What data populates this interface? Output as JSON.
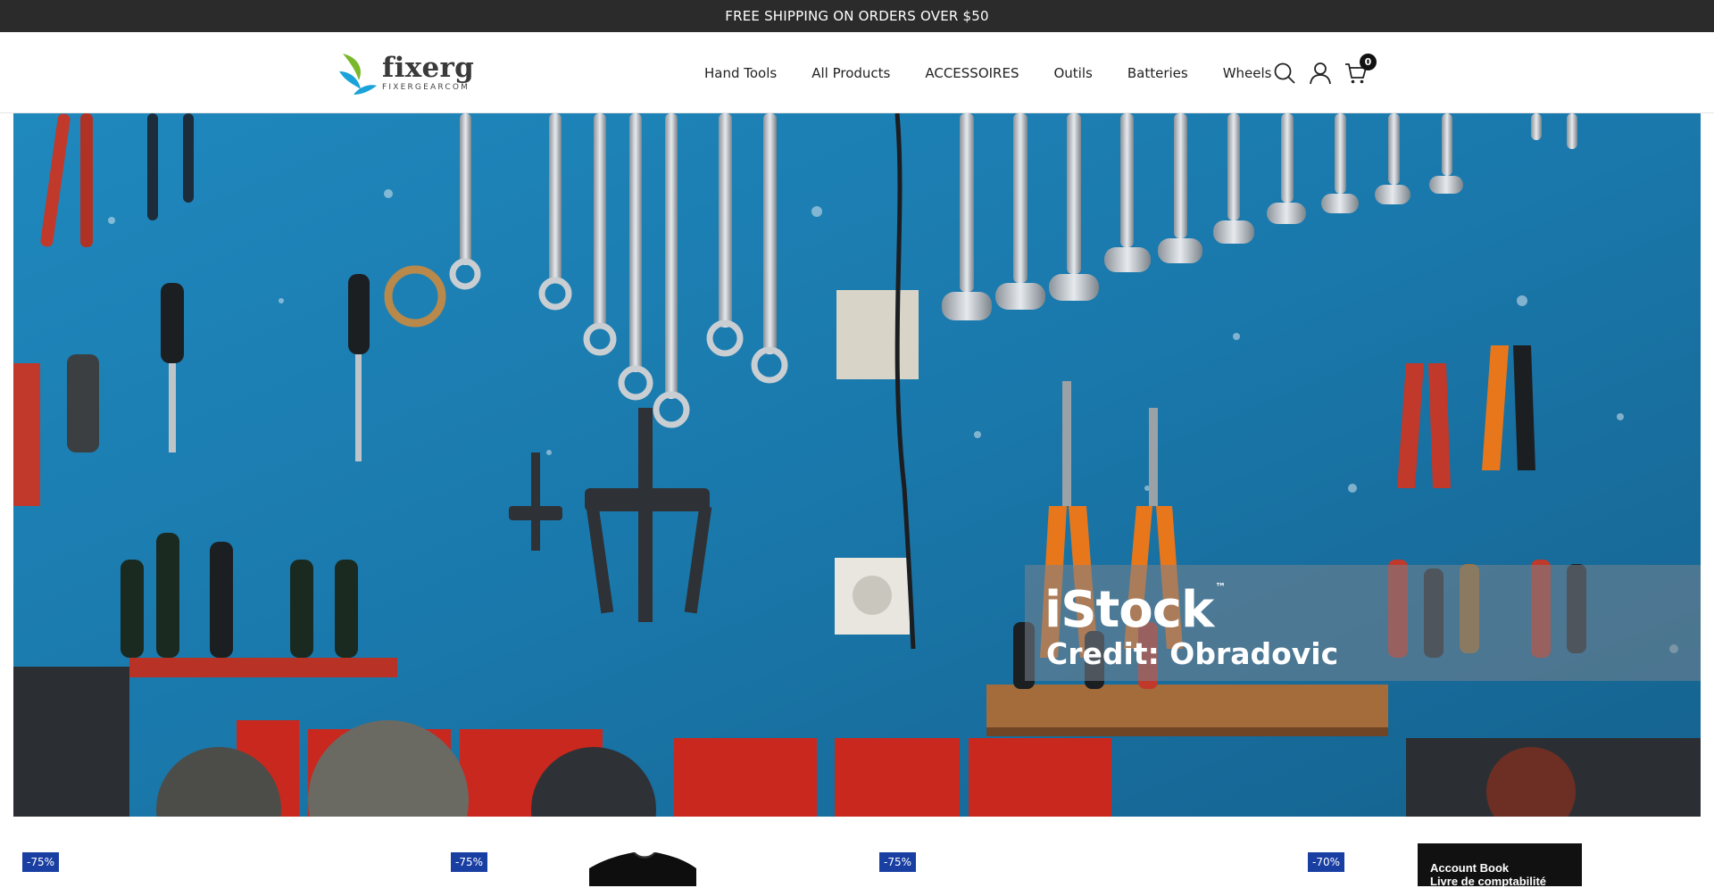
{
  "announcement": "FREE SHIPPING ON ORDERS OVER $50",
  "brand": {
    "name": "fixerg",
    "tagline": "FIXERGEARCOM"
  },
  "nav": [
    "Hand Tools",
    "All Products",
    "ACCESSOIRES",
    "Outils",
    "Batteries",
    "Wheels"
  ],
  "header_icons": {
    "search": "search-icon",
    "account": "user-icon",
    "cart": "cart-icon",
    "cart_count": "0"
  },
  "hero": {
    "watermark_brand": "iStock",
    "watermark_tm": "™",
    "watermark_credit": "Credit: Obradovic"
  },
  "products": {
    "badges": [
      "-75%",
      "-75%",
      "-75%",
      "-70%"
    ],
    "book_title_line1": "Account Book",
    "book_title_line2": "Livre de comptabilité"
  },
  "colors": {
    "topbar": "#2b2b2b",
    "badge": "#1a3fa3",
    "hero_wall": "#1b7fb0"
  }
}
